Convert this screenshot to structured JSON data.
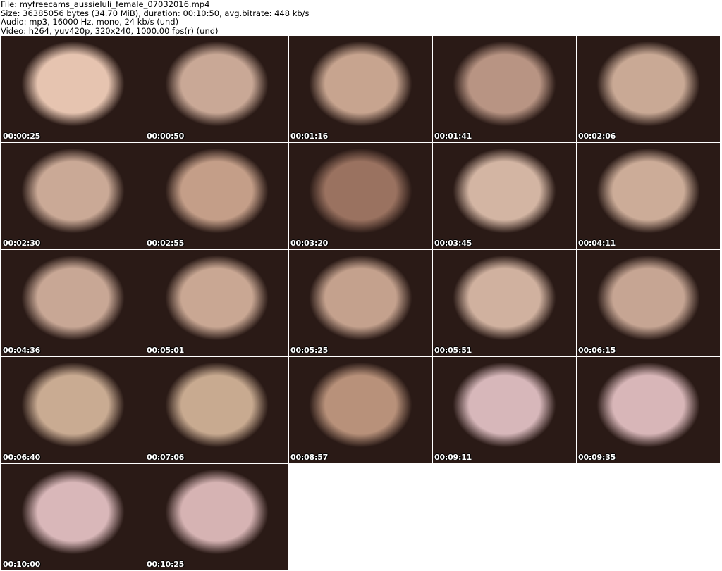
{
  "header": {
    "file": "File: myfreecams_aussieluli_female_07032016.mp4",
    "size": "Size: 36385056 bytes (34.70 MiB), duration: 00:10:50, avg.bitrate: 448 kb/s",
    "audio": "Audio: mp3, 16000 Hz, mono, 24 kb/s (und)",
    "video": "Video: h264, yuv420p, 320x240, 1000.00 fps(r) (und)"
  },
  "thumbnails": [
    {
      "time": "00:00:25",
      "tone": "#e6c4b0"
    },
    {
      "time": "00:00:50",
      "tone": "#c9a896"
    },
    {
      "time": "00:01:16",
      "tone": "#c7a48f"
    },
    {
      "time": "00:01:41",
      "tone": "#b89483"
    },
    {
      "time": "00:02:06",
      "tone": "#c9a995"
    },
    {
      "time": "00:02:30",
      "tone": "#caa996"
    },
    {
      "time": "00:02:55",
      "tone": "#c49e88"
    },
    {
      "time": "00:03:20",
      "tone": "#9a7260"
    },
    {
      "time": "00:03:45",
      "tone": "#d3b5a3"
    },
    {
      "time": "00:04:11",
      "tone": "#ccac98"
    },
    {
      "time": "00:04:36",
      "tone": "#c8a795"
    },
    {
      "time": "00:05:01",
      "tone": "#c9a793"
    },
    {
      "time": "00:05:25",
      "tone": "#c4a18d"
    },
    {
      "time": "00:05:51",
      "tone": "#d0b19f"
    },
    {
      "time": "00:06:15",
      "tone": "#c6a593"
    },
    {
      "time": "00:06:40",
      "tone": "#c9ab92"
    },
    {
      "time": "00:07:06",
      "tone": "#c8aa90"
    },
    {
      "time": "00:08:57",
      "tone": "#b8917a"
    },
    {
      "time": "00:09:11",
      "tone": "#d7b7ba"
    },
    {
      "time": "00:09:35",
      "tone": "#d8b6b8"
    },
    {
      "time": "00:10:00",
      "tone": "#d9b7b9"
    },
    {
      "time": "00:10:25",
      "tone": "#d6b3b3"
    }
  ]
}
